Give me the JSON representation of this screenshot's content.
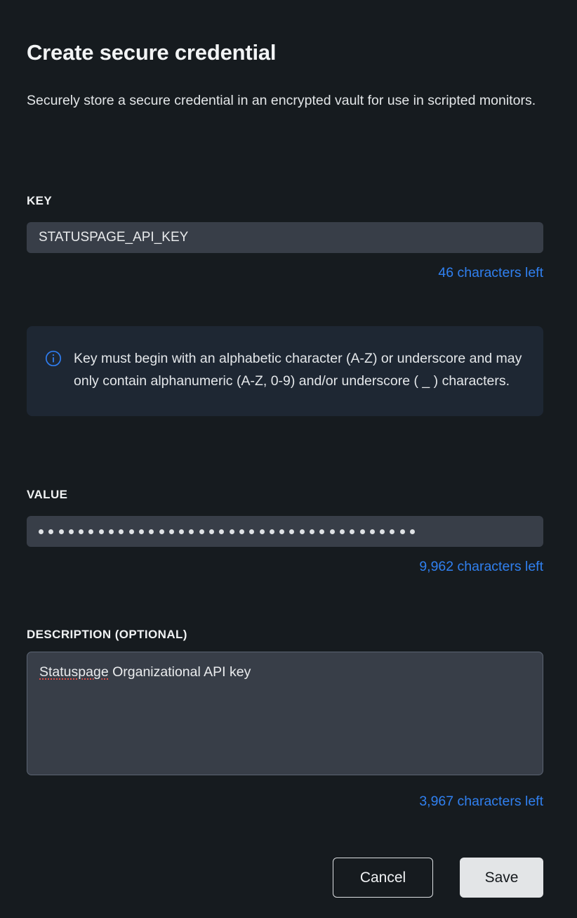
{
  "dialog": {
    "title": "Create secure credential",
    "description": "Securely store a secure credential in an encrypted vault for use in scripted monitors."
  },
  "key_field": {
    "label": "KEY",
    "value": "STATUSPAGE_API_KEY",
    "placeholder": "",
    "counter": "46 characters left"
  },
  "info_callout": {
    "icon": "info-circle-icon",
    "text": "Key must begin with an alphabetic character (A-Z) or underscore and may only contain alphanumeric (A-Z, 0-9) and/or underscore ( _ ) characters."
  },
  "value_field": {
    "label": "VALUE",
    "masked": true,
    "masked_character_count": 38,
    "counter": "9,962 characters left"
  },
  "description_field": {
    "label": "DESCRIPTION (OPTIONAL)",
    "value_spellchecked_word": "Statuspage",
    "value_rest": " Organizational API key",
    "value": "Statuspage Organizational API key",
    "counter": "3,967 characters left"
  },
  "actions": {
    "cancel_label": "Cancel",
    "save_label": "Save"
  },
  "colors": {
    "page_background": "#161b1f",
    "input_background": "#383e48",
    "info_background": "#1e2733",
    "accent_blue": "#3080f0",
    "save_button_background": "#e3e5e7",
    "spellcheck_underline": "#e0504a"
  }
}
